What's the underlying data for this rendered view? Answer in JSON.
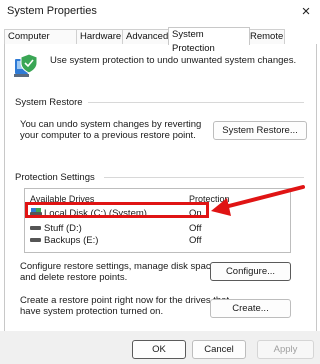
{
  "window": {
    "title": "System Properties",
    "close_icon": "×"
  },
  "tabs": [
    {
      "label": "Computer Name",
      "active": false
    },
    {
      "label": "Hardware",
      "active": false
    },
    {
      "label": "Advanced",
      "active": false
    },
    {
      "label": "System Protection",
      "active": true
    },
    {
      "label": "Remote",
      "active": false
    }
  ],
  "intro": "Use system protection to undo unwanted system changes.",
  "system_restore": {
    "label": "System Restore",
    "desc_line1": "You can undo system changes by reverting",
    "desc_line2": "your computer to a previous restore point.",
    "button": "System Restore..."
  },
  "protection": {
    "label": "Protection Settings",
    "col_drives": "Available Drives",
    "col_protection": "Protection",
    "drives": [
      {
        "name": "Local Disk (C:) (System)",
        "protection": "On",
        "icon": "system-drive-icon"
      },
      {
        "name": "Stuff (D:)",
        "protection": "Off",
        "icon": "drive-icon"
      },
      {
        "name": "Backups (E:)",
        "protection": "Off",
        "icon": "drive-icon"
      }
    ]
  },
  "configure": {
    "line1": "Configure restore settings, manage disk space,",
    "line2": "and delete restore points.",
    "button": "Configure..."
  },
  "create": {
    "line1": "Create a restore point right now for the drives that",
    "line2": "have system protection turned on.",
    "button": "Create..."
  },
  "footer": {
    "ok": "OK",
    "cancel": "Cancel",
    "apply": "Apply"
  },
  "colors": {
    "annotation": "#e01414",
    "accent_blue": "#2f7bd6",
    "shield_green": "#3aa655"
  }
}
